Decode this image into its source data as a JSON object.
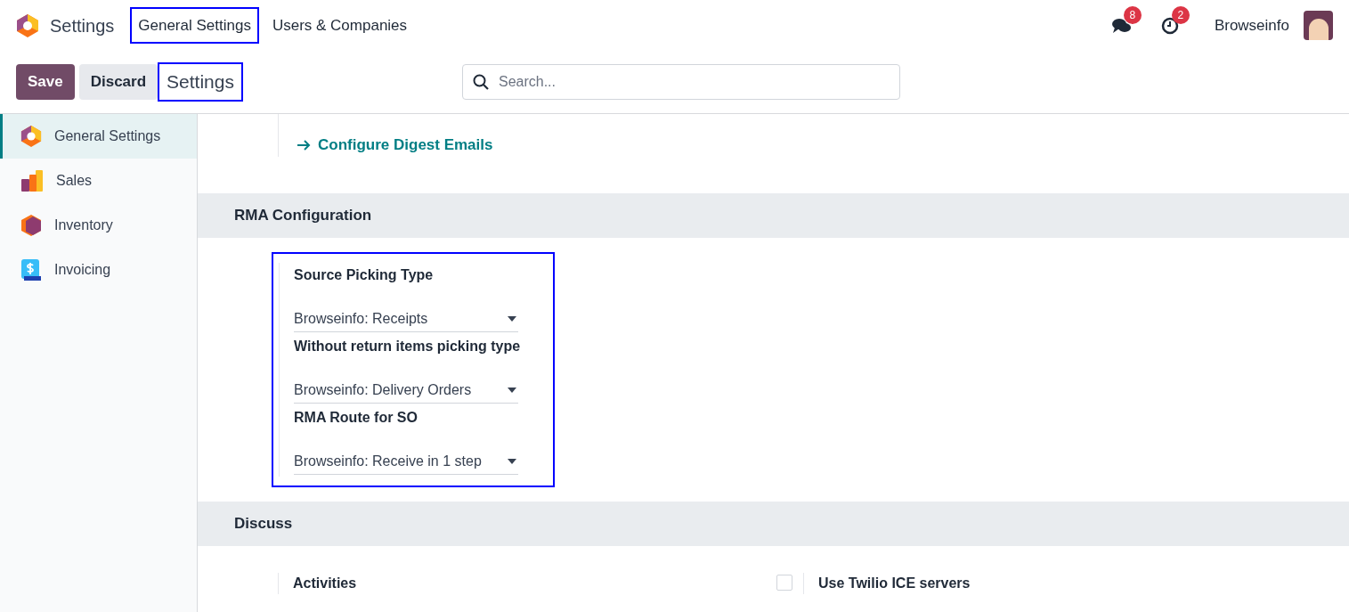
{
  "app": {
    "title": "Settings"
  },
  "menu": [
    {
      "label": "General Settings",
      "highlighted": true
    },
    {
      "label": "Users & Companies",
      "highlighted": false
    }
  ],
  "systray": {
    "messages_count": "8",
    "activities_count": "2",
    "user": "Browseinfo"
  },
  "control_panel": {
    "save": "Save",
    "discard": "Discard",
    "breadcrumb": "Settings",
    "breadcrumb_highlighted": true,
    "search": {
      "placeholder": "Search..."
    }
  },
  "sidebar": {
    "items": [
      {
        "label": "General Settings",
        "kind": "general",
        "selected": true
      },
      {
        "label": "Sales",
        "kind": "sales",
        "selected": false
      },
      {
        "label": "Inventory",
        "kind": "inventory",
        "selected": false
      },
      {
        "label": "Invoicing",
        "kind": "invoicing",
        "selected": false
      }
    ]
  },
  "link": "Configure Digest Emails",
  "sections": [
    {
      "title": "RMA Configuration",
      "highlighted": true,
      "fields": [
        {
          "kind": "select",
          "label": "Source Picking Type",
          "value": "Browseinfo: Receipts"
        },
        {
          "kind": "select",
          "label": "Without return items picking type",
          "value": "Browseinfo: Delivery Orders"
        },
        {
          "kind": "select",
          "label": "RMA Route for SO",
          "value": "Browseinfo: Receive in 1 step"
        }
      ]
    },
    {
      "title": "Discuss",
      "highlighted": false,
      "fields": [
        {
          "kind": "plain",
          "label": "Activities"
        },
        {
          "kind": "checkbox",
          "label": "Use Twilio ICE servers",
          "checked": false
        }
      ]
    }
  ]
}
